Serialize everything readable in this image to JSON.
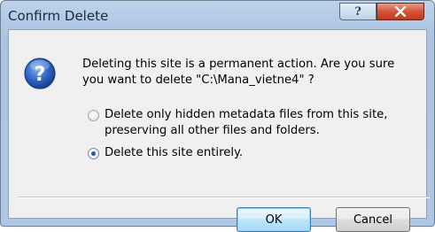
{
  "window": {
    "title": "Confirm Delete"
  },
  "titlebar": {
    "help_label": "?"
  },
  "message": {
    "line1": "Deleting this site is a permanent action.  Are you sure",
    "line2": "you want to delete \"C:\\Mana_vietne4\" ?"
  },
  "options": [
    {
      "line1": "Delete only hidden metadata files from this site,",
      "line2": "preserving all other files and folders.",
      "selected": false
    },
    {
      "line1": "Delete this site entirely.",
      "selected": true
    }
  ],
  "buttons": {
    "ok_label": "OK",
    "cancel_label": "Cancel"
  },
  "icons": {
    "message_icon": "question-icon",
    "close_icon": "close-icon"
  }
}
